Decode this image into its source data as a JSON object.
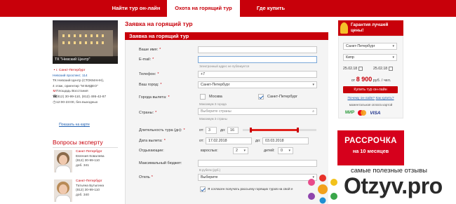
{
  "nav": {
    "tabs": [
      {
        "label": "Найти тур он-лайн"
      },
      {
        "label": "Охота на горящий тур"
      },
      {
        "label": "Где купить"
      }
    ]
  },
  "office": {
    "photo_caption": "ТК \"Невский Центр\"",
    "city": "г. Санкт-Петербург",
    "street": "Невский проспект, 114",
    "mall": "ТК Невский Центр (СТОКМАНН),",
    "floor": "4 этаж, ориентир \"М ВИДЕО\"",
    "metro": "Площадь Восстания",
    "phones": "(812) 30-99-110, (812) 495-42-87",
    "hours": "12:00-23:00, без выходных",
    "map_link": "Показать на карте"
  },
  "experts": {
    "title": "Вопросы эксперту",
    "items": [
      {
        "city": "Санкт-Петербург",
        "name": "Евгения Ковалева",
        "phone": "(812) 30-99-110",
        "ext": "доб. 341"
      },
      {
        "city": "Санкт-Петербург",
        "name": "Татьяна Бутыгина",
        "phone": "(812) 30-99-110",
        "ext": "доб. 340"
      }
    ]
  },
  "page": {
    "title": "Заявка на горящий тур"
  },
  "form": {
    "header": "Заявка на горящий тур",
    "name_label": "Ваше имя:",
    "email_label": "E-mail:",
    "email_hint": "Электронный адрес не публикуется",
    "phone_label": "Телефон:",
    "phone_value": "+7",
    "city_label": "Ваш город:",
    "city_value": "Санкт-Петербург",
    "departure_label": "Города вылета:",
    "departure_options": [
      "Москва",
      "Санкт-Петербург"
    ],
    "departure_hint_moscow": "Максимум 3 города",
    "departure_hint_spb": "Максимум 3 города",
    "countries_label": "Страны:",
    "countries_placeholder": "Выберите страны",
    "countries_hint": "Максимум 3 страны",
    "duration_label": "Длительность тура (дн):",
    "duration_from_label": "от:",
    "duration_from": "3",
    "duration_to_label": "до:",
    "duration_to": "16",
    "duration_range": {
      "from": 3,
      "to": 16
    },
    "date_label": "Дата вылета:",
    "date_from_label": "от:",
    "date_from": "17.02.2018",
    "date_to_label": "до:",
    "date_to": "03.03.2018",
    "travelers_label": "Отдыхающие:",
    "adults_label": "взрослых:",
    "adults_value": "2",
    "children_label": "детей:",
    "children_value": "0",
    "budget_label": "Максимальный бюджет:",
    "budget_hint": "В рублях (руб.)",
    "hotel_label": "Отель",
    "hotel_value": "Выберите",
    "consent_text": "Я согласен получать рассылку горящих туров на свой е"
  },
  "search_box": {
    "guarantee": "Гарантия лучшей цены!",
    "from_city": "Санкт-Петербург",
    "country": "Кипр",
    "date_from": "25.02.18",
    "date_to": "25.02.18",
    "price_prefix": "от",
    "price_value": "8 900",
    "price_suffix": "руб. / чел.",
    "buy_button": "Купить тур он-лайн",
    "link_cheaper": "Почему он-лайн?",
    "link_how": "Как купить?",
    "installment_text": "моментальная оплата картой",
    "pay_mir": "МИР",
    "pay_visa": "VISA"
  },
  "promo": {
    "title": "РАССРОЧКА",
    "subtitle_line1": "на 10 месяцев"
  },
  "watermark": {
    "tagline": "самые полезные отзывы",
    "brand": "Otzyv.pro"
  },
  "colors": {
    "brand_red": "#c8000a",
    "link_blue": "#1f5fb0",
    "promo_red": "#d6001c"
  }
}
